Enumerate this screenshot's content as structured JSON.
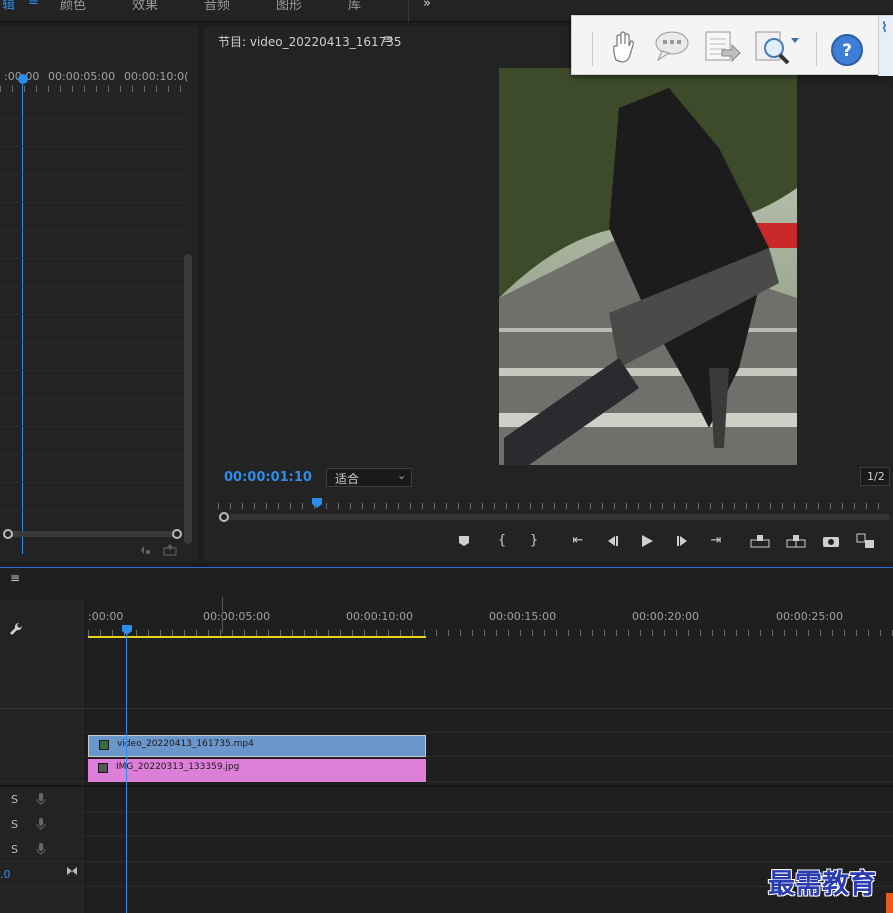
{
  "workspace_tabs": [
    "辑",
    "≡",
    "颜色",
    "效果",
    "音频",
    "图形",
    "库",
    "»"
  ],
  "source_panel": {
    "timecodes": [
      ":00:00",
      "00:00:05:00",
      "00:00:10:0("
    ]
  },
  "program_panel": {
    "title": "节目: video_20220413_161735",
    "menu_icon": "≡",
    "timecode": "00:00:01:10",
    "fit_option": "适合",
    "resolution": "1/2",
    "playhead_fraction": 0.25
  },
  "timeline": {
    "menu_icon": "≡",
    "ruler_labels": [
      ":00:00",
      "00:00:05:00",
      "00:00:10:00",
      "00:00:15:00",
      "00:00:20:00",
      "00:00:25:00"
    ],
    "clips": {
      "video": "video_20220413_161735.mp4",
      "image": "IMG_20220313_133359.jpg"
    },
    "audio_tracks": [
      {
        "solo": "S"
      },
      {
        "solo": "S"
      },
      {
        "solo": "S"
      }
    ],
    "master_value": ".0"
  },
  "watermark": "最需教育",
  "accent_color": "#2d8ceb"
}
